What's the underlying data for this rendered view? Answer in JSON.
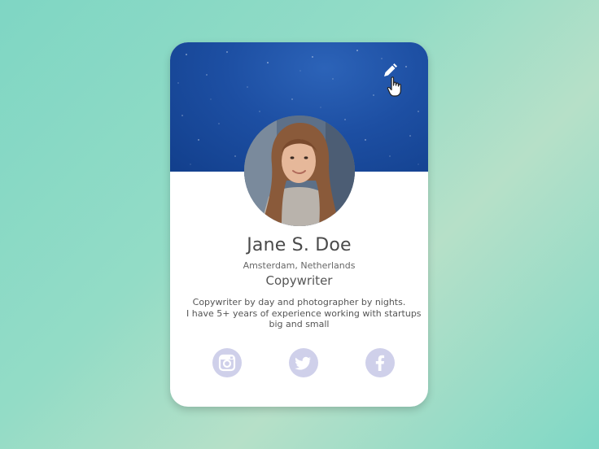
{
  "profile": {
    "name": "Jane S. Doe",
    "location": "Amsterdam, Netherlands",
    "job_title": "Copywriter",
    "bio_lines": [
      "Copywriter by day and photographer by nights.",
      "I have 5+ years of experience working with startups",
      "big and small"
    ]
  },
  "icons": {
    "edit": "pencil-icon",
    "cursor": "hand-pointer-icon",
    "social": [
      "instagram-icon",
      "twitter-icon",
      "facebook-icon"
    ]
  },
  "colors": {
    "background": "#86d9c5",
    "cover": "#1d4fa3",
    "social_button": "#cfd0ea",
    "social_glyph": "#ffffff",
    "text": "#4a4a4a"
  }
}
